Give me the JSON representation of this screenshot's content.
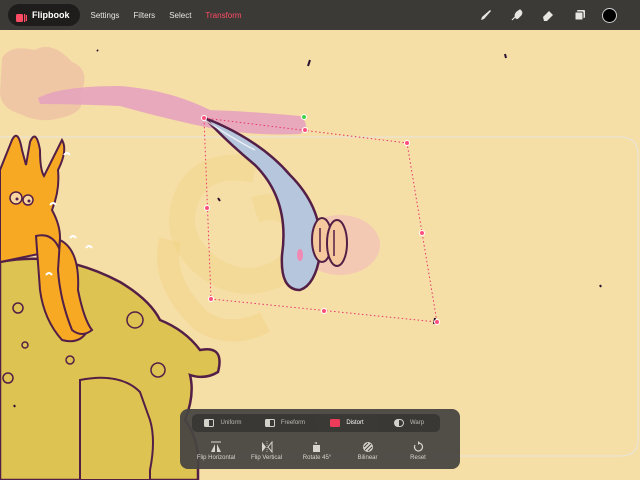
{
  "app": {
    "name": "Flipbook"
  },
  "menu": {
    "items": [
      {
        "label": "Settings"
      },
      {
        "label": "Filters"
      },
      {
        "label": "Select"
      },
      {
        "label": "Transform"
      }
    ],
    "active": "Transform"
  },
  "tools": [
    {
      "icon": "brush-icon"
    },
    {
      "icon": "smudge-icon"
    },
    {
      "icon": "eraser-icon"
    },
    {
      "icon": "layers-icon"
    },
    {
      "icon": "color-swatch",
      "color": "#000000"
    }
  ],
  "transform_panel": {
    "modes": [
      {
        "label": "Uniform"
      },
      {
        "label": "Freeform"
      },
      {
        "label": "Distort"
      },
      {
        "label": "Warp"
      }
    ],
    "active_mode": "Distort",
    "actions": [
      {
        "label": "Flip Horizontal",
        "icon": "flip-horizontal-icon"
      },
      {
        "label": "Flip Vertical",
        "icon": "flip-vertical-icon"
      },
      {
        "label": "Rotate 45°",
        "icon": "rotate-icon"
      },
      {
        "label": "Bilinear",
        "icon": "bilinear-icon"
      },
      {
        "label": "Reset",
        "icon": "reset-icon"
      }
    ]
  },
  "colors": {
    "canvas_bg": "#f6dfa7",
    "toolbar_bg": "#3c3a37",
    "accent": "#ff4b63",
    "selection": "#e8346a"
  }
}
